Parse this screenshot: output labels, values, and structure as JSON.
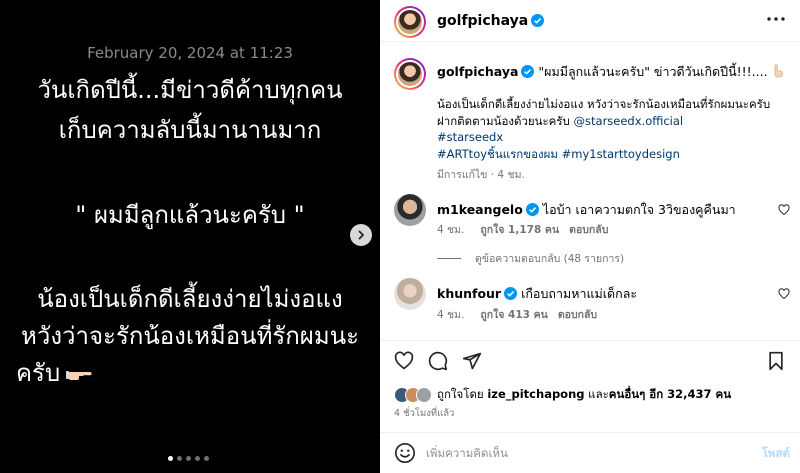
{
  "media": {
    "timestamp": "February 20, 2024 at 11:23",
    "lines": [
      "วันเกิดปีนี้...มีข่าวดีค้าบทุกคน",
      "เก็บความลับนี้มานานมาก",
      "\" ผมมีลูกแล้วนะครับ \"",
      "น้องเป็นเด็กดีเลี้ยงง่ายไม่งอแง",
      "หวังว่าจะรักน้องเหมือนที่รักผมนะ",
      "ครับ"
    ],
    "carousel_pages": 5,
    "carousel_active": 1
  },
  "header": {
    "username": "golfpichaya"
  },
  "caption": {
    "username": "golfpichaya",
    "headline": " \"ผมมีลูกแล้วนะครับ\" ข่าวดีวันเกิดปีนี้!!!....",
    "body_line1": "น้องเป็นเด็กดีเลี้ยงง่ายไม่งอแง หวังว่าจะรักน้องเหมือนที่รักผมนะครับ",
    "body_line2_prefix": "ฝากติดตามน้องด้วยนะครับ ",
    "mention": "@starseedx.official",
    "tag1": "#starseedx",
    "tag2": "#ARTtoyชิ้นแรกของผม",
    "tag3": "#my1starttoydesign",
    "edited": "มีการแก้ไข",
    "time": "4 ชม."
  },
  "comments": [
    {
      "username": "m1keangelo",
      "text": "ไอบ้า เอาความตกใจ 3วิของคูคืนมา",
      "time": "4 ชม.",
      "likes": "ถูกใจ 1,178 คน",
      "reply": "ตอบกลับ"
    },
    {
      "username": "khunfour",
      "text": "เกือบถามหาแม่เด็กละ",
      "time": "4 ชม.",
      "likes": "ถูกใจ 413 คน",
      "reply": "ตอบกลับ"
    }
  ],
  "replies_toggle": "ดูข้อความตอบกลับ (48 รายการ)",
  "likes_line": {
    "prefix": "ถูกใจโดย ",
    "user": "ize_pitchapong",
    "middle": " และ",
    "others": "คนอื่นๆ อีก 32,437 คน"
  },
  "posted_ago": "4 ชั่วโมงที่แล้ว",
  "composer": {
    "placeholder": "เพิ่มความคิดเห็น",
    "post_label": "โพสต์"
  },
  "colors": {
    "verified": "#0095f6",
    "link": "#00376b",
    "muted": "#737373",
    "post_disabled": "#b3dbff"
  },
  "icons": [
    "more-icon",
    "verified-icon",
    "heart-icon",
    "comment-icon",
    "share-icon",
    "save-icon",
    "emoji-icon",
    "chevron-right-icon",
    "pointing-hand-emoji"
  ]
}
